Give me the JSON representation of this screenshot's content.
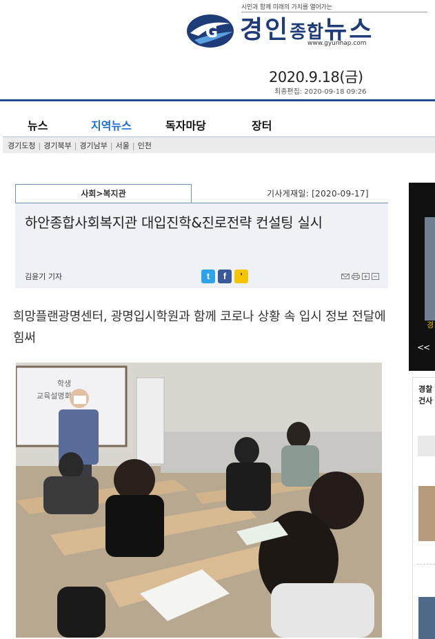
{
  "header": {
    "slogan": "시민과 함께 미래의 가치를 열어가는",
    "logo_main": "경인",
    "logo_small": "종합",
    "logo_end": "뉴스",
    "logo_url": "www.gyunhap.com",
    "date": "2020.9.18(금)",
    "last_edit": "최종편집: 2020-09-18 09:26"
  },
  "nav": {
    "items": [
      {
        "label": "뉴스"
      },
      {
        "label": "지역뉴스"
      },
      {
        "label": "독자마당"
      },
      {
        "label": "장터"
      }
    ],
    "sub_items": [
      {
        "label": "경기도청"
      },
      {
        "label": "경기북부"
      },
      {
        "label": "경기남부"
      },
      {
        "label": "서울"
      },
      {
        "label": "인천"
      }
    ],
    "sub_sep": "|"
  },
  "article": {
    "section": "사회>복지관",
    "published": "기사게재일: [2020-09-17]",
    "headline": "하안종합사회복지관 대입진학&진로전략 컨설팅 실시",
    "byline": "김윤기 기자",
    "share": {
      "twitter": "t",
      "facebook": "f",
      "kakao": "’"
    },
    "subtitle": "희망플랜광명센터, 광명입시학원과 함께 코로나 상황 속 입시 정보 전달에 힘써",
    "photo_board_lines": [
      "학생",
      "교육설명회"
    ]
  },
  "sidebar": {
    "arrows": "<<",
    "dark_text": "경",
    "box_title_1": "경찰",
    "box_title_2": "건사"
  },
  "colors": {
    "brand": "#1e3c78",
    "nav_border": "#1d4a88",
    "nav_active": "#1a6fd0",
    "title_bg": "#eef2f7"
  }
}
